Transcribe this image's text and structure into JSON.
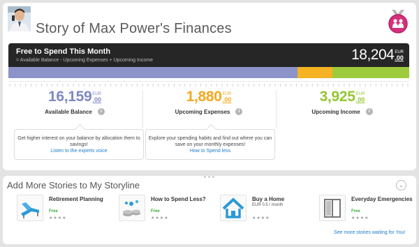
{
  "header": {
    "title": "Story of Max Power's Finances"
  },
  "summary": {
    "title": "Free to Spend This Month",
    "formula": "= Available Balance - Upcoming Expenses + Upcoming Income",
    "amount": "18,204",
    "currency": "EUR",
    "decimals": ".00"
  },
  "spend_bar": {
    "segments": [
      {
        "name": "available-balance",
        "fraction": 0.722,
        "color": "#8b93c8"
      },
      {
        "name": "upcoming-expenses",
        "fraction": 0.087,
        "color": "#f5b324"
      },
      {
        "name": "upcoming-income",
        "fraction": 0.191,
        "color": "#9dcb3b"
      }
    ]
  },
  "stats": [
    {
      "amount": "16,159",
      "currency": "EUR",
      "decimals": ".00",
      "label": "Available Balance",
      "color": "#7f88c4",
      "info": "i"
    },
    {
      "amount": "1,880",
      "currency": "EUR",
      "decimals": ".00",
      "label": "Upcoming Expenses",
      "color": "#f5a81e",
      "info": "i"
    },
    {
      "amount": "3,925",
      "currency": "EUR",
      "decimals": ".00",
      "label": "Upcoming Income",
      "color": "#94c633",
      "info": "i"
    }
  ],
  "tips": [
    {
      "text": "Get higher interest on your balance by allocation them to savings!",
      "link": "Listen to the experts voice"
    },
    {
      "text": "Explore your spending habits and find out where you can save on your monthly expenses!",
      "link": "How to Spend less"
    }
  ],
  "stories_section": {
    "title": "Add More Stories to My Storyline",
    "collapse_icon": "⌄",
    "more_link": "See more stories waiting for You!",
    "items": [
      {
        "name": "Retirement Planning",
        "price": "Free",
        "stars": "★★★★",
        "icon": "lounge-chair-icon"
      },
      {
        "name": "How to Spend Less?",
        "price": "Free",
        "stars": "★★★★",
        "icon": "coins-icon"
      },
      {
        "name": "Buy a Home",
        "price": "EUR 0.5 / month",
        "stars": "★★★★",
        "icon": "house-icon"
      },
      {
        "name": "Everyday Emergencies",
        "price": "Free",
        "stars": "★★★★",
        "icon": "window-icon"
      }
    ]
  },
  "colors": {
    "accent_pink": "#d6307d",
    "link_blue": "#1a7bc9",
    "price_green": "#3aaa35"
  }
}
